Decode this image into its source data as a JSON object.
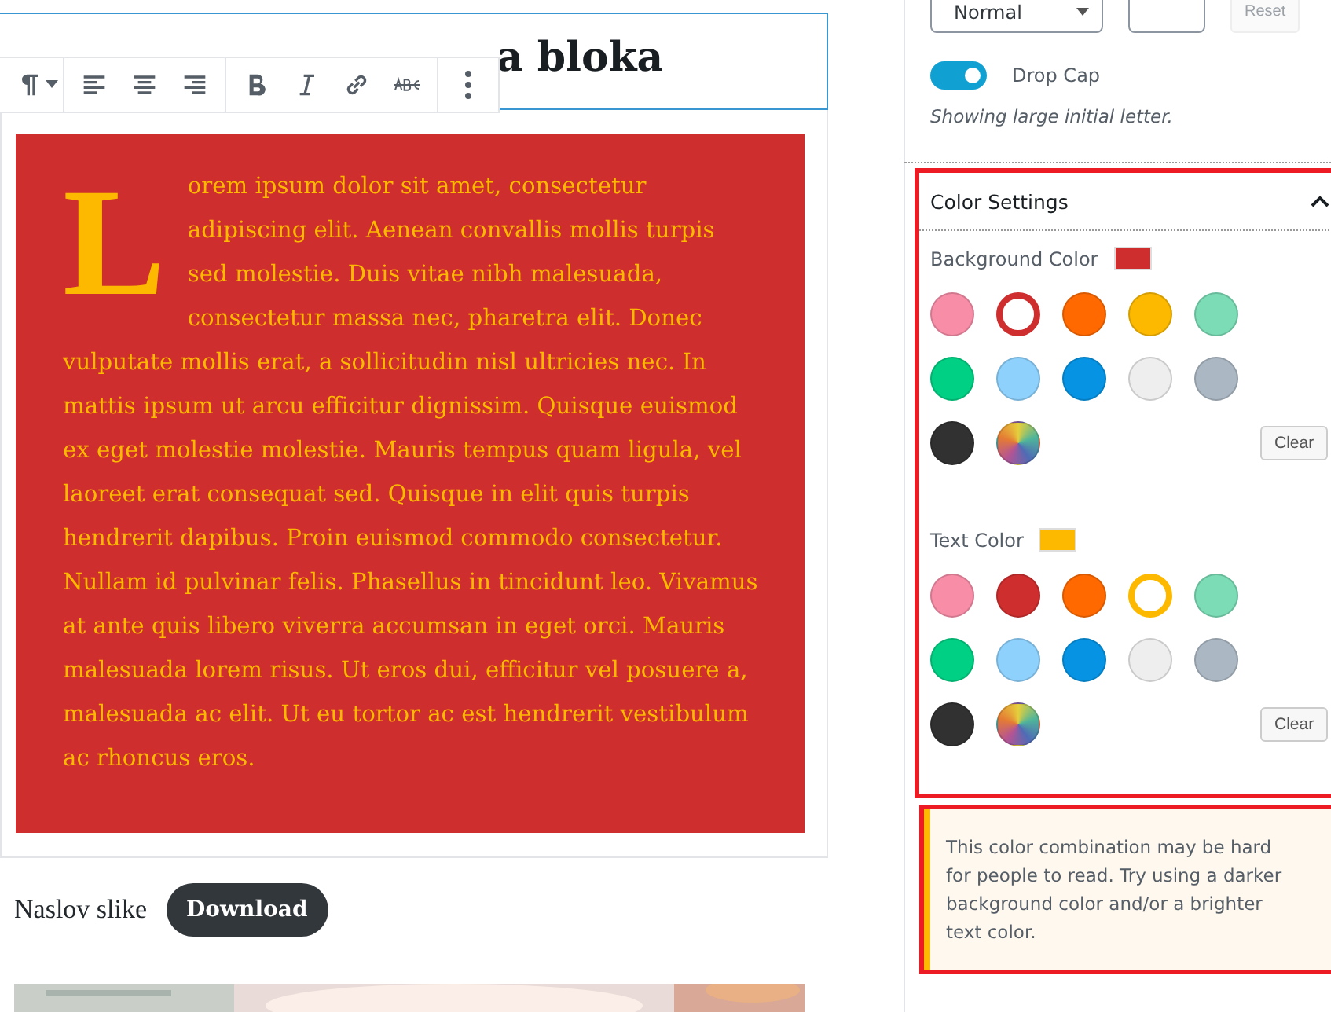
{
  "editor": {
    "heading": {
      "text": "a bloka"
    },
    "toolbar": {
      "buttons": [
        {
          "kind": "paragraph"
        },
        {
          "kind": "align-left"
        },
        {
          "kind": "align-center"
        },
        {
          "kind": "align-right"
        },
        {
          "kind": "bold"
        },
        {
          "kind": "italic"
        },
        {
          "kind": "link"
        },
        {
          "kind": "strikethrough"
        },
        {
          "kind": "more"
        }
      ]
    },
    "paragraph": {
      "drop_cap_letter": "L",
      "text": "orem ipsum dolor sit amet, consectetur adipiscing elit. Aenean convallis mollis turpis sed molestie. Duis vitae nibh malesuada, consectetur massa nec, pharetra elit. Donec vulputate mollis erat, a sollicitudin nisl ultricies nec. In mattis ipsum ut arcu efficitur dignissim. Quisque euismod ex eget molestie molestie. Mauris tempus quam ligula, vel laoreet erat consequat sed. Quisque in elit quis turpis hendrerit dapibus. Proin euismod commodo consectetur. Nullam id pulvinar felis. Phasellus in tincidunt leo. Vivamus at ante quis libero viverra accumsan in eget orci. Mauris malesuada lorem risus. Ut eros dui, efficitur vel posuere a, malesuada ac elit. Ut eu tortor ac est hendrerit vestibulum ac rhoncus eros."
    },
    "caption": {
      "text": "Naslov slike",
      "button": "Download"
    }
  },
  "sidebar": {
    "font_size_select": {
      "value": "Normal"
    },
    "reset_button": {
      "label": "Reset",
      "disabled": true
    },
    "drop_cap": {
      "label": "Drop Cap",
      "on": true,
      "help": "Showing large initial letter."
    },
    "color_settings": {
      "title": "Color Settings",
      "expanded": true,
      "sections": [
        {
          "label": "Background Color",
          "clear": "Clear",
          "swatches": [
            {
              "kind": "solid",
              "color": "#f78da7",
              "selected": false
            },
            {
              "kind": "solid",
              "color": "#cf2e2e",
              "selected": true
            },
            {
              "kind": "solid",
              "color": "#ff6900",
              "selected": false
            },
            {
              "kind": "solid",
              "color": "#fcb900",
              "selected": false
            },
            {
              "kind": "solid",
              "color": "#7bdcb5",
              "selected": false
            },
            {
              "kind": "solid",
              "color": "#00d084",
              "selected": false
            },
            {
              "kind": "solid",
              "color": "#8ed1fc",
              "selected": false
            },
            {
              "kind": "solid",
              "color": "#0693e3",
              "selected": false
            },
            {
              "kind": "solid",
              "color": "#eeeeee",
              "selected": false
            },
            {
              "kind": "solid",
              "color": "#abb8c3",
              "selected": false
            },
            {
              "kind": "solid",
              "color": "#313131",
              "selected": false
            },
            {
              "kind": "custom",
              "selected": false
            }
          ]
        },
        {
          "label": "Text Color",
          "clear": "Clear",
          "swatches": [
            {
              "kind": "solid",
              "color": "#f78da7",
              "selected": false
            },
            {
              "kind": "solid",
              "color": "#cf2e2e",
              "selected": false
            },
            {
              "kind": "solid",
              "color": "#ff6900",
              "selected": false
            },
            {
              "kind": "solid",
              "color": "#fcb900",
              "selected": true
            },
            {
              "kind": "solid",
              "color": "#7bdcb5",
              "selected": false
            },
            {
              "kind": "solid",
              "color": "#00d084",
              "selected": false
            },
            {
              "kind": "solid",
              "color": "#8ed1fc",
              "selected": false
            },
            {
              "kind": "solid",
              "color": "#0693e3",
              "selected": false
            },
            {
              "kind": "solid",
              "color": "#eeeeee",
              "selected": false
            },
            {
              "kind": "solid",
              "color": "#abb8c3",
              "selected": false
            },
            {
              "kind": "solid",
              "color": "#313131",
              "selected": false
            },
            {
              "kind": "custom",
              "selected": false
            }
          ]
        }
      ]
    },
    "notice": "This color combination may be hard for people to read. Try using a darker background color and/or a brighter text color."
  }
}
